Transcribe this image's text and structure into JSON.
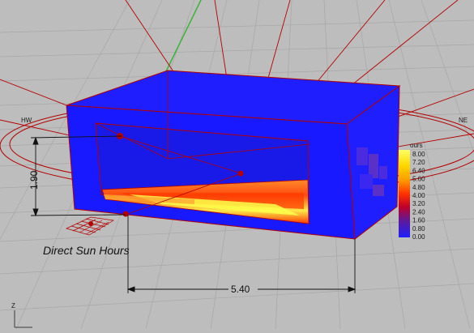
{
  "viewport": {
    "analysis_title": "Direct Sun Hours",
    "dimension_width": "5.40",
    "dimension_height": "1.90",
    "axis_label_z": "Z",
    "colors": {
      "background": "#bdbdbd",
      "box_blue": "#1919ff",
      "edge_red": "#b40000",
      "axis_green": "#3cb43c"
    }
  },
  "legend": {
    "header": "ours",
    "values": [
      "8.00",
      "7.20",
      "6.40",
      "5.60",
      "4.80",
      "4.00",
      "3.20",
      "2.40",
      "1.60",
      "0.80",
      "0.00"
    ],
    "gradient": [
      "#ffff66",
      "#ffd700",
      "#ff9900",
      "#ff3300",
      "#c0002a",
      "#5a1aa0",
      "#1e1eff"
    ]
  },
  "compass_labels": {
    "left": "HW",
    "right": "NE"
  }
}
